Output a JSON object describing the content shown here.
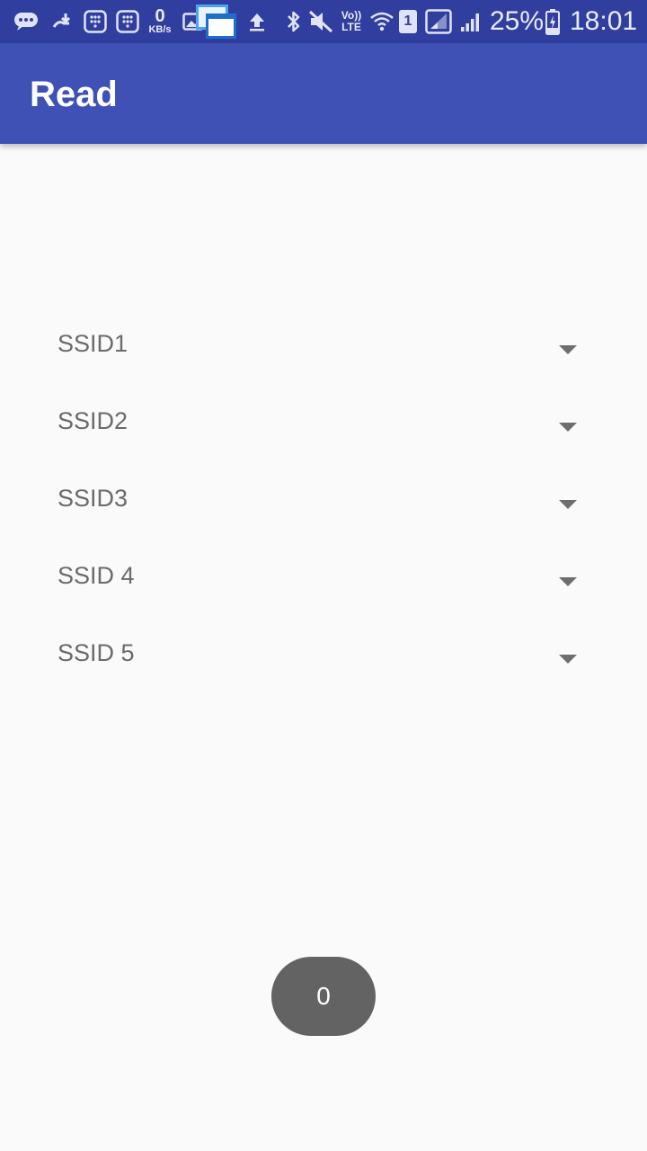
{
  "status_bar": {
    "speed_value": "0",
    "speed_unit": "KB/s",
    "volte_top": "Vo))",
    "volte_bottom": "LTE",
    "sim_number": "1",
    "battery_percent": "25%",
    "time": "18:01",
    "icons": [
      "chat-icon",
      "download-icon",
      "dialpad-icon",
      "dialpad-icon",
      "gallery-icon",
      "window-icon",
      "upload-icon",
      "bluetooth-icon",
      "mute-icon",
      "volte-icon",
      "wifi-icon",
      "sim-icon",
      "signal-icon",
      "signal-icon",
      "battery-icon"
    ]
  },
  "app_bar": {
    "title": "Read",
    "color": "#3f51b5",
    "status_color": "#303f9f"
  },
  "spinners": [
    {
      "label": "SSID1"
    },
    {
      "label": "SSID2"
    },
    {
      "label": "SSID3"
    },
    {
      "label": "SSID 4"
    },
    {
      "label": "SSID 5"
    }
  ],
  "counter": {
    "value": "0",
    "color": "#636363"
  }
}
